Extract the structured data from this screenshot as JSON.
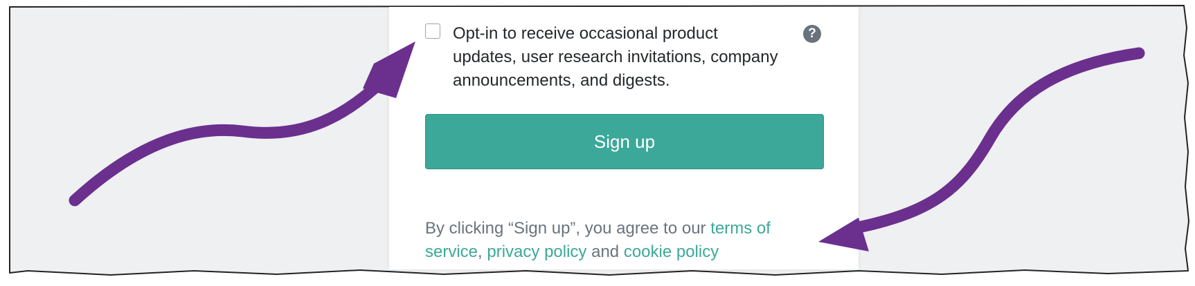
{
  "optin": {
    "label": "Opt-in to receive occasional product updates, user research invitations, company announcements, and digests.",
    "checked": false,
    "help_icon": "question-mark-icon"
  },
  "signup": {
    "button_label": "Sign up"
  },
  "legal": {
    "prefix": "By clicking “Sign up”, you agree to our ",
    "terms_link": "terms of service",
    "separator": ", ",
    "privacy_link": "privacy policy",
    "conjunction": " and ",
    "cookie_link": "cookie policy"
  },
  "colors": {
    "page_background": "#eef0f2",
    "accent": "#3ca899",
    "arrow": "#6b2f8e",
    "text": "#242729",
    "muted_text": "#6a737c"
  },
  "annotations": {
    "arrow_icons": [
      "curved-arrow-to-checkbox",
      "curved-arrow-to-legal-links"
    ]
  }
}
